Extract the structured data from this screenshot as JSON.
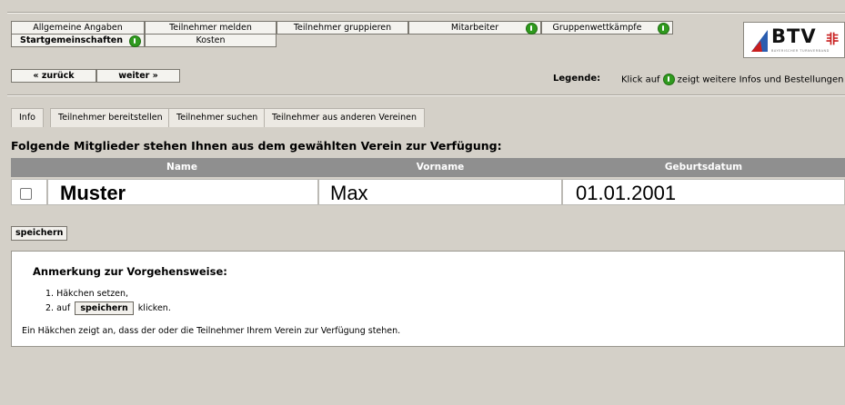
{
  "nav": {
    "row1": [
      {
        "label": "Allgemeine Angaben",
        "info": false
      },
      {
        "label": "Teilnehmer melden",
        "info": false
      },
      {
        "label": "Teilnehmer gruppieren",
        "info": false
      },
      {
        "label": "Mitarbeiter",
        "info": true
      },
      {
        "label": "Gruppenwettkämpfe",
        "info": true
      }
    ],
    "row2": [
      {
        "label": "Startgemeinschaften",
        "info": true
      },
      {
        "label": "Kosten",
        "info": false
      }
    ],
    "back_label": "« zurück",
    "next_label": "weiter »"
  },
  "logo": {
    "text": "BTV",
    "mark": "⾮",
    "subtitle": "BAYERISCHER TURNVERBAND"
  },
  "legend": {
    "label": "Legende:",
    "text_before": "Klick auf",
    "text_after": "zeigt weitere Infos und Bestellungen an"
  },
  "tabs": [
    "Info",
    "Teilnehmer bereitstellen",
    "Teilnehmer suchen",
    "Teilnehmer aus anderen Vereinen"
  ],
  "section_title": "Folgende Mitglieder stehen Ihnen aus dem gewählten Verein zur Verfügung:",
  "table": {
    "columns": [
      "Name",
      "Vorname",
      "Geburtsdatum"
    ],
    "rows": [
      {
        "name": "Muster",
        "vorname": "Max",
        "geburtsdatum": "01.01.2001",
        "checked": false
      }
    ]
  },
  "save_label": "speichern",
  "note": {
    "title": "Anmerkung zur Vorgehensweise:",
    "step1": "1. Häkchen setzen,",
    "step2_before": "2. auf",
    "step2_button": "speichern",
    "step2_after": "klicken.",
    "footer": "Ein Häkchen zeigt an, dass der oder die Teilnehmer Ihrem Verein zur Verfügung stehen."
  },
  "colors": {
    "info_icon": "#2f9a1e",
    "table_header": "#8f8f8f",
    "logo_mark": "#c81e1e",
    "logo_flag": "#2a5db0"
  }
}
